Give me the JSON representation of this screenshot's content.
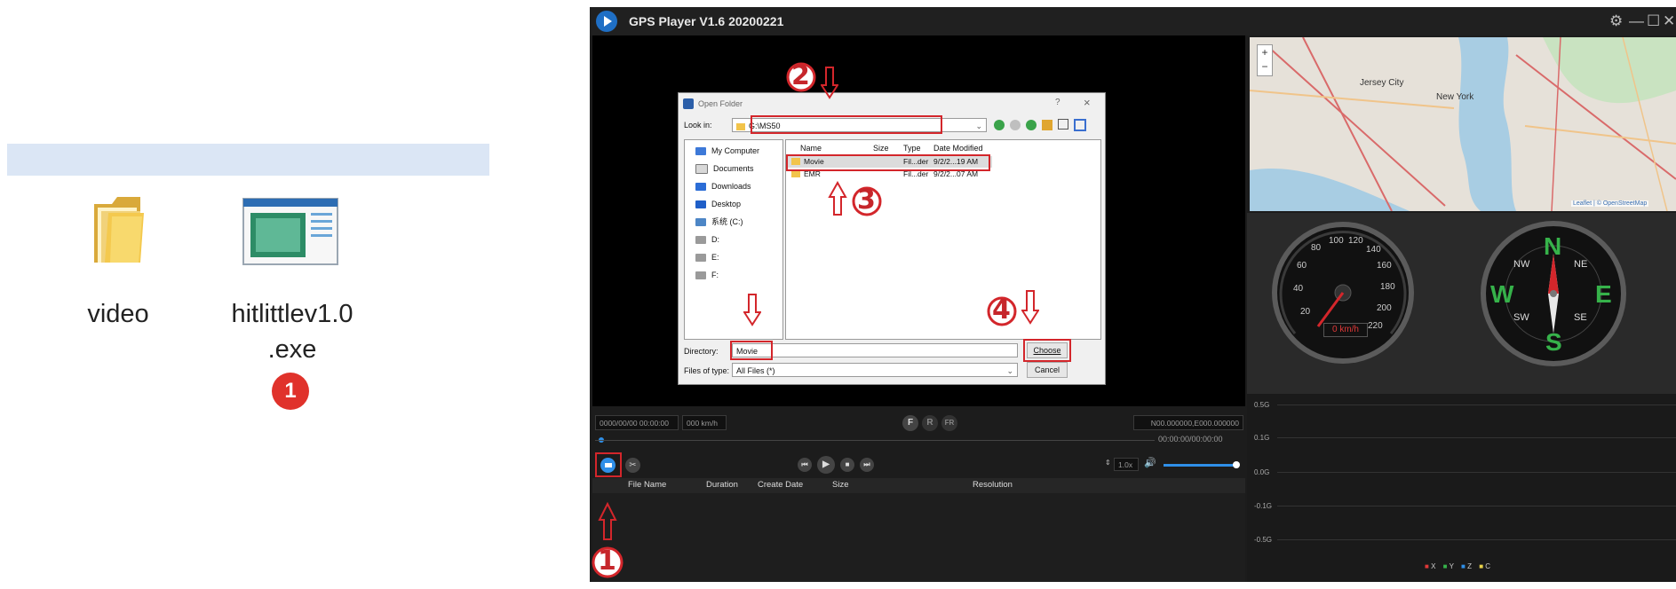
{
  "explorer": {
    "items": [
      {
        "label": "video",
        "icon": "folder-icon"
      },
      {
        "label_line1": "hitlittlev1.0",
        "label_line2": ".exe",
        "icon": "exe-icon"
      }
    ],
    "badge": "1"
  },
  "app": {
    "title": "GPS Player V1.6 20200221",
    "status": {
      "datetime": "0000/00/00 00:00:00",
      "speed": "000 km/h",
      "coords": "N00.000000,E000.000000",
      "timecode": "00:00:00/00:00:00"
    },
    "buttons": {
      "f": "F",
      "r": "R",
      "fr": "FR"
    },
    "playback_speed": "1.0x",
    "table_headers": [
      "File Name",
      "Duration",
      "Create Date",
      "Size",
      "Resolution"
    ],
    "map": {
      "zoom_in": "+",
      "zoom_out": "−",
      "labels": [
        "Jersey City",
        "New York"
      ],
      "attribution": "Leaflet | © OpenStreetMap"
    },
    "speedometer": {
      "ticks": [
        "20",
        "40",
        "60",
        "80",
        "100",
        "120",
        "140",
        "160",
        "180",
        "200",
        "220"
      ],
      "readout": "0 km/h"
    },
    "compass": {
      "n": "N",
      "e": "E",
      "s": "S",
      "w": "W",
      "ne": "NE",
      "nw": "NW",
      "se": "SE",
      "sw": "SW"
    },
    "gsensor": {
      "yticks": [
        "0.5G",
        "0.1G",
        "0.0G",
        "-0.1G",
        "-0.5G"
      ],
      "legend": [
        "X",
        "Y",
        "Z",
        "C"
      ]
    }
  },
  "dialog": {
    "title": "Open Folder",
    "help": "?",
    "close": "×",
    "look_in_label": "Look in:",
    "look_in_value": "G:\\MS50",
    "nav": [
      "My Computer",
      "Documents",
      "Downloads",
      "Desktop",
      "系统 (C:)",
      "D:",
      "E:",
      "F:"
    ],
    "columns": [
      "Name",
      "Size",
      "Type",
      "Date Modified"
    ],
    "rows": [
      {
        "name": "Movie",
        "type": "Fil...der",
        "date": "9/2/2...19 AM"
      },
      {
        "name": "EMR",
        "type": "Fil...der",
        "date": "9/2/2...07 AM"
      }
    ],
    "directory_label": "Directory:",
    "directory_value": "Movie",
    "filetype_label": "Files of type:",
    "filetype_value": "All Files (*)",
    "choose": "Choose",
    "cancel": "Cancel"
  },
  "steps": [
    "2",
    "3",
    "4",
    "1"
  ],
  "colors": {
    "annotation_red": "#d3262b",
    "badge_red": "#e0322b",
    "accent_blue": "#2f8fe8"
  }
}
